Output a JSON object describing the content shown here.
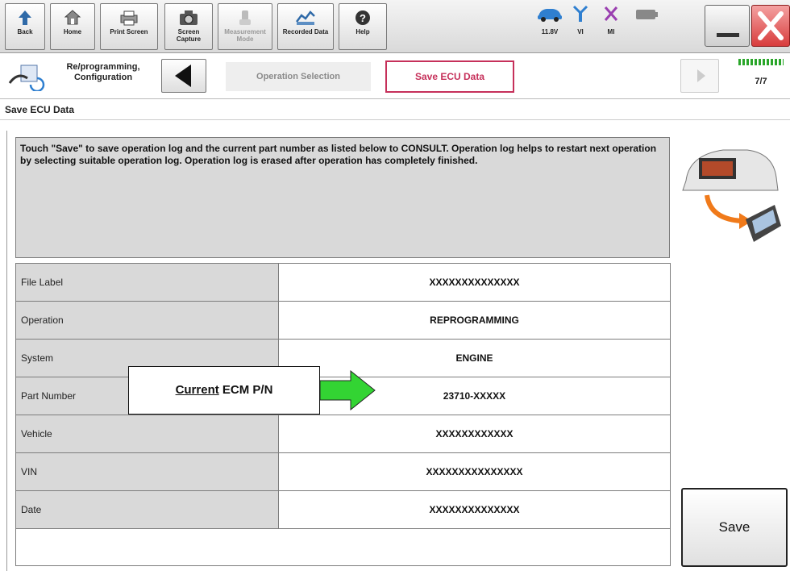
{
  "toolbar": {
    "back_label": "Back",
    "home_label": "Home",
    "print_label": "Print Screen",
    "capture_label": "Screen Capture",
    "measurement_label": "Measurement Mode",
    "recorded_label": "Recorded Data",
    "help_label": "Help",
    "voltage": "11.8V",
    "vi_label": "VI",
    "mi_label": "MI"
  },
  "nav": {
    "section_label": "Re/programming, Configuration",
    "step_operation_selection": "Operation Selection",
    "step_save_ecu_data": "Save ECU Data",
    "progress_text": "7/7",
    "progress_fraction": 1.0
  },
  "page": {
    "title": "Save ECU Data"
  },
  "instructions": "Touch \"Save\" to save operation log and the current part number as listed below to CONSULT. Operation log helps to restart next operation by selecting suitable operation log. Operation log is erased after operation has completely finished.",
  "table": {
    "rows": [
      {
        "label": "File Label",
        "value": "XXXXXXXXXXXXXX"
      },
      {
        "label": "Operation",
        "value": "REPROGRAMMING"
      },
      {
        "label": "System",
        "value": "ENGINE"
      },
      {
        "label": "Part Number",
        "value": "23710-XXXXX"
      },
      {
        "label": "Vehicle",
        "value": "XXXXXXXXXXXX"
      },
      {
        "label": "VIN",
        "value": "XXXXXXXXXXXXXXX"
      },
      {
        "label": "Date",
        "value": "XXXXXXXXXXXXXX"
      }
    ]
  },
  "callout": {
    "underlined": "Current",
    "rest": " ECM P/N"
  },
  "save_label": "Save",
  "colors": {
    "accent": "#c6305a",
    "arrow_green": "#33d433",
    "panel_gray": "#d9d9d9"
  }
}
